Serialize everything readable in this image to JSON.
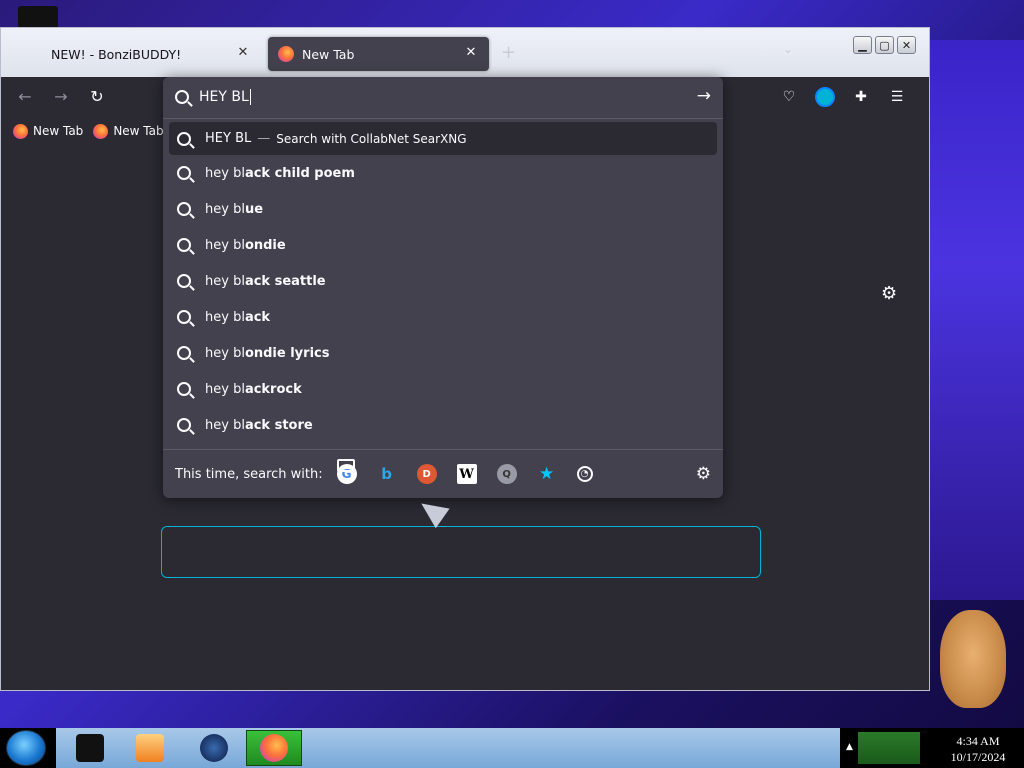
{
  "browser": {
    "tabs": [
      {
        "label": "NEW! - BonziBUDDY!",
        "active": false
      },
      {
        "label": "New Tab",
        "active": true
      }
    ],
    "bookmarks": [
      "New Tab",
      "New Tab"
    ]
  },
  "urlbar": {
    "query": "HEY BL",
    "top_result": {
      "text": "HEY BL",
      "separator": "—",
      "action": "Search with CollabNet SearXNG"
    },
    "suggestions": [
      {
        "prefix": "hey bl",
        "rest": "ack child poem"
      },
      {
        "prefix": "hey bl",
        "rest": "ue"
      },
      {
        "prefix": "hey bl",
        "rest": "ondie"
      },
      {
        "prefix": "hey bl",
        "rest": "ack seattle"
      },
      {
        "prefix": "hey bl",
        "rest": "ack"
      },
      {
        "prefix": "hey bl",
        "rest": "ondie lyrics"
      },
      {
        "prefix": "hey bl",
        "rest": "ackrock"
      },
      {
        "prefix": "hey bl",
        "rest": "ack store"
      }
    ],
    "footer_label": "This time, search with:",
    "engines": [
      "google-icon",
      "bing-icon",
      "duckduckgo-icon",
      "wikipedia-icon",
      "searxng-icon",
      "bookmarks-star-icon",
      "tabs-icon",
      "history-icon"
    ],
    "engine_glyphs": {
      "google": "G",
      "bing": "b",
      "ddg": "D",
      "wiki": "W",
      "searx": "Q"
    }
  },
  "taskbar": {
    "clock_time": "4:34 AM",
    "clock_date": "10/17/2024"
  },
  "colors": {
    "toolbar_bg": "#2b2a33",
    "panel_bg": "#42414d",
    "accent": "#00b3d6"
  }
}
